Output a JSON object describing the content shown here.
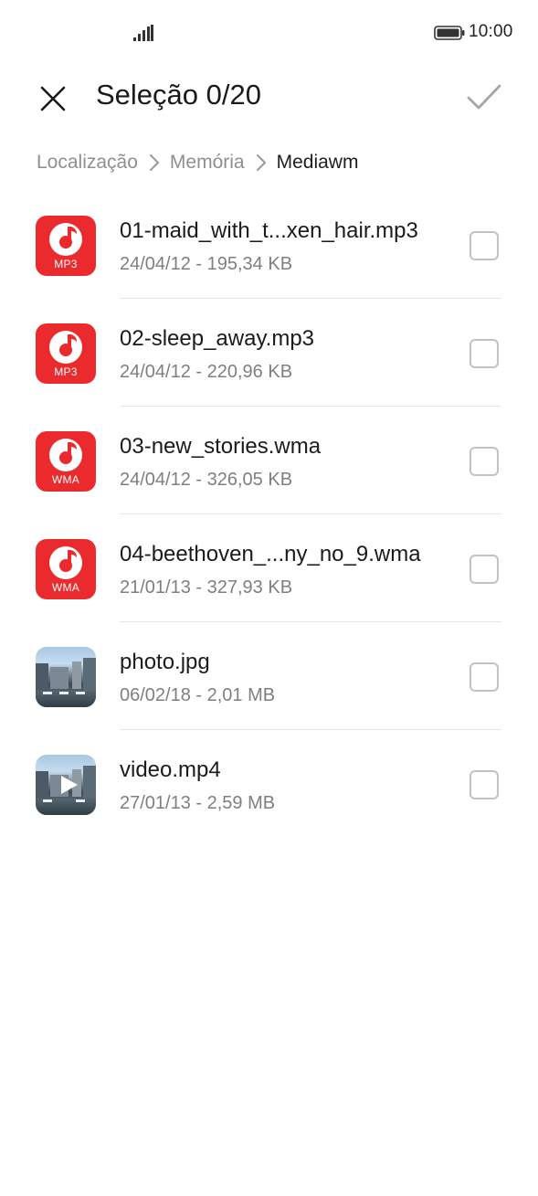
{
  "status_bar": {
    "time": "10:00",
    "signal_icon": "signal-icon",
    "battery_icon": "battery-icon"
  },
  "header": {
    "title": "Seleção 0/20",
    "close_icon": "close-icon",
    "confirm_icon": "check-icon"
  },
  "breadcrumb": [
    "Localização",
    "Memória",
    "Mediawm"
  ],
  "colors": {
    "audio_icon_bg": "#ea2a2c",
    "secondary_text": "#7f7f7f",
    "checkbox_border": "#c2c2c2"
  },
  "files": [
    {
      "name": "01-maid_with_t...xen_hair.mp3",
      "meta": "24/04/12 - 195,34 KB",
      "type": "audio",
      "ext": "MP3",
      "selected": false
    },
    {
      "name": "02-sleep_away.mp3",
      "meta": "24/04/12 - 220,96 KB",
      "type": "audio",
      "ext": "MP3",
      "selected": false
    },
    {
      "name": "03-new_stories.wma",
      "meta": "24/04/12 - 326,05 KB",
      "type": "audio",
      "ext": "WMA",
      "selected": false
    },
    {
      "name": "04-beethoven_...ny_no_9.wma",
      "meta": "21/01/13 - 327,93 KB",
      "type": "audio",
      "ext": "WMA",
      "selected": false
    },
    {
      "name": "photo.jpg",
      "meta": "06/02/18 - 2,01 MB",
      "type": "image",
      "selected": false
    },
    {
      "name": "video.mp4",
      "meta": "27/01/13 - 2,59 MB",
      "type": "video",
      "selected": false
    }
  ]
}
